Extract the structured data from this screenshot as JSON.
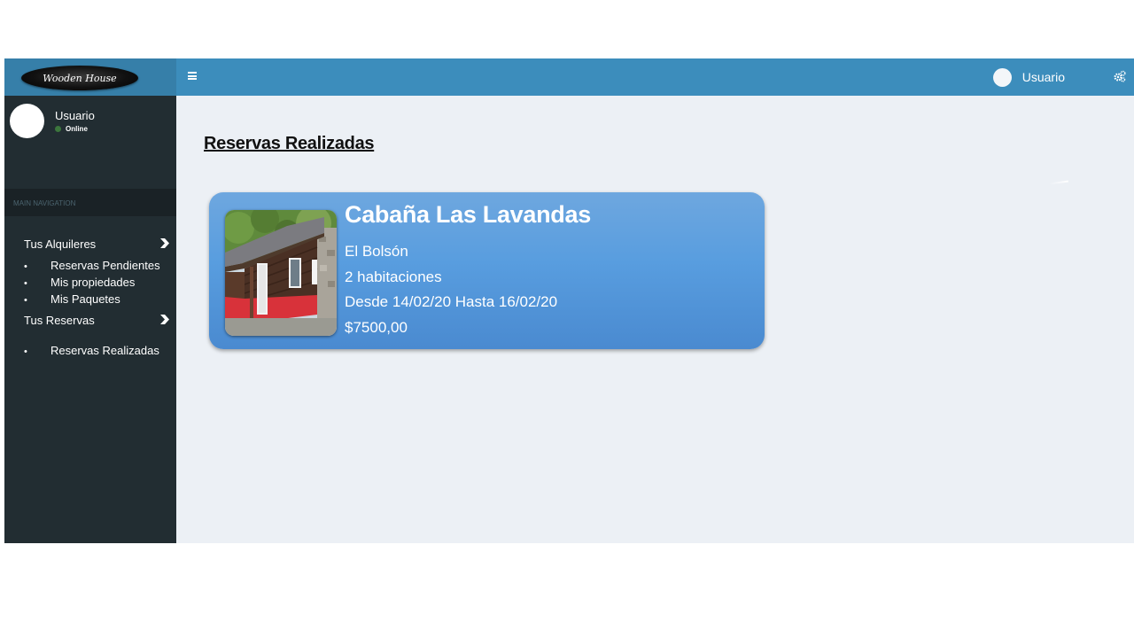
{
  "brand": {
    "logo_text": "Wooden House"
  },
  "header": {
    "user_name": "Usuario",
    "menu_icon": "hamburger-icon",
    "settings_icon": "gears-icon"
  },
  "sidebar": {
    "user_name": "Usuario",
    "status": "Online",
    "nav_header": "MAIN NAVIGATION",
    "groups": [
      {
        "label": "Tus Alquileres",
        "items": [
          "Reservas Pendientes",
          "Mis propiedades",
          "Mis Paquetes"
        ]
      },
      {
        "label": "Tus Reservas",
        "items": [
          "Reservas Realizadas"
        ]
      }
    ],
    "bullet": "•"
  },
  "main": {
    "title": "Reservas Realizadas",
    "reservations": [
      {
        "name": "Cabaña Las Lavandas",
        "location": "El Bolsón",
        "rooms": "2 habitaciones",
        "dates": "Desde 14/02/20 Hasta 16/02/20",
        "price": "$7500,00"
      }
    ]
  },
  "colors": {
    "topbar": "#3c8dbc",
    "logo_area": "#367fa9",
    "sidebar": "#222d32",
    "content_bg": "#ecf0f5",
    "card": "#589ddf"
  }
}
